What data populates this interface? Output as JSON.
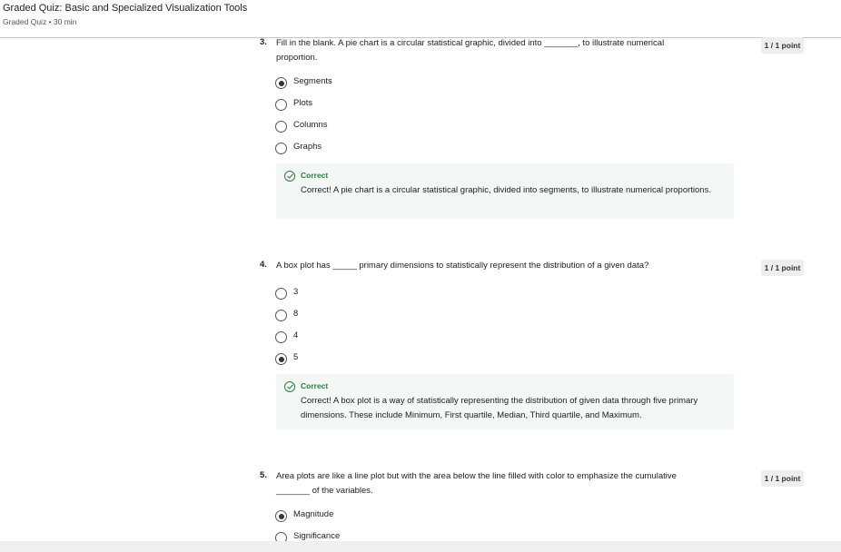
{
  "header": {
    "title": "Graded Quiz: Basic and Specialized Visualization Tools",
    "subtitle": "Graded Quiz • 30 min"
  },
  "questions": [
    {
      "number": "3.",
      "prompt": "Fill in the blank. A pie chart is a circular statistical graphic, divided into _______, to illustrate numerical proportion.",
      "points": "1 / 1 point",
      "options": [
        {
          "label": "Segments",
          "selected": true
        },
        {
          "label": "Plots",
          "selected": false
        },
        {
          "label": "Columns",
          "selected": false
        },
        {
          "label": "Graphs",
          "selected": false
        }
      ],
      "feedback": {
        "status": "Correct",
        "explanation": "Correct! A pie chart is a circular statistical graphic, divided into segments, to illustrate numerical proportions."
      }
    },
    {
      "number": "4.",
      "prompt": "A box plot has _____ primary dimensions to statistically represent the distribution of a given data?",
      "points": "1 / 1 point",
      "options": [
        {
          "label": "3",
          "selected": false
        },
        {
          "label": "8",
          "selected": false
        },
        {
          "label": "4",
          "selected": false
        },
        {
          "label": "5",
          "selected": true
        }
      ],
      "feedback": {
        "status": "Correct",
        "explanation": "Correct! A box plot is a way of statistically representing the distribution of given data through five primary dimensions. These include Minimum, First quartile, Median, Third quartile, and Maximum."
      }
    },
    {
      "number": "5.",
      "prompt": "Area plots are like a line plot but with the area below the line filled with color to emphasize the cumulative _______ of the variables.",
      "points": "1 / 1 point",
      "options": [
        {
          "label": "Magnitude",
          "selected": true
        },
        {
          "label": "Significance",
          "selected": false
        }
      ]
    }
  ],
  "colors": {
    "correct": "#2e7d43",
    "feedback_bg": "#f3f7f5",
    "points_bg": "#eeeeee"
  }
}
